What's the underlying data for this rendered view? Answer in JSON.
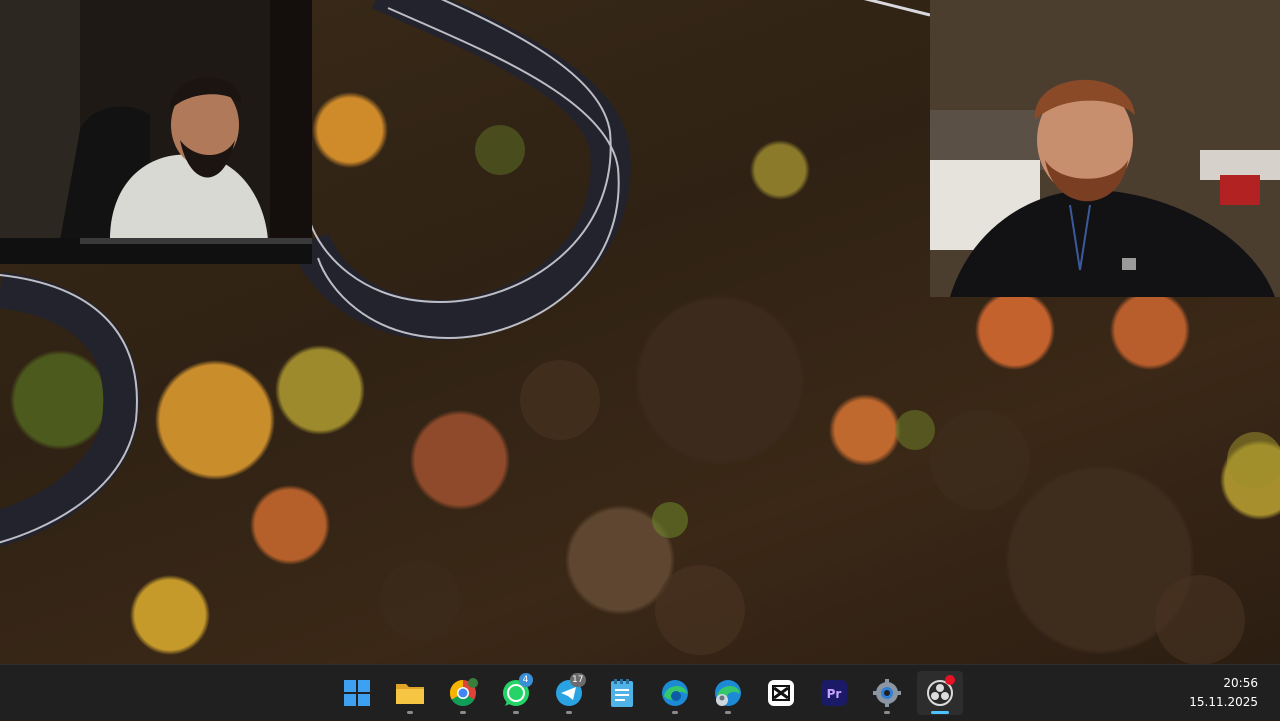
{
  "taskbar": {
    "apps": [
      {
        "name": "start-button",
        "icon": "windows-logo-icon",
        "active": false,
        "running": false,
        "badge": ""
      },
      {
        "name": "file-explorer",
        "icon": "folder-icon",
        "active": false,
        "running": true,
        "badge": ""
      },
      {
        "name": "google-chrome",
        "icon": "chrome-icon",
        "active": false,
        "running": true,
        "badge": ""
      },
      {
        "name": "whatsapp",
        "icon": "whatsapp-icon",
        "active": false,
        "running": true,
        "badge": "4"
      },
      {
        "name": "telegram",
        "icon": "telegram-icon",
        "active": false,
        "running": true,
        "badge": "17"
      },
      {
        "name": "notepad",
        "icon": "notepad-icon",
        "active": false,
        "running": false,
        "badge": ""
      },
      {
        "name": "microsoft-edge",
        "icon": "edge-icon",
        "active": false,
        "running": true,
        "badge": ""
      },
      {
        "name": "microsoft-edge-profile",
        "icon": "edge-profile-icon",
        "active": false,
        "running": true,
        "badge": ""
      },
      {
        "name": "capcut",
        "icon": "capcut-icon",
        "active": false,
        "running": false,
        "badge": ""
      },
      {
        "name": "adobe-premiere-pro",
        "icon": "premiere-pro-icon",
        "active": false,
        "running": false,
        "badge": ""
      },
      {
        "name": "settings",
        "icon": "gear-icon",
        "active": false,
        "running": true,
        "badge": ""
      },
      {
        "name": "obs-studio",
        "icon": "obs-icon",
        "active": true,
        "running": true,
        "badge": ""
      }
    ],
    "clock": {
      "time": "20:56",
      "date": "15.11.2025"
    }
  },
  "colors": {
    "taskbar_bg": "#202020",
    "active_indicator": "#4cc2ff",
    "whatsapp": "#25d366",
    "telegram": "#2aa3e3",
    "premiere": "#1a1a66",
    "record_dot": "#e81123"
  }
}
